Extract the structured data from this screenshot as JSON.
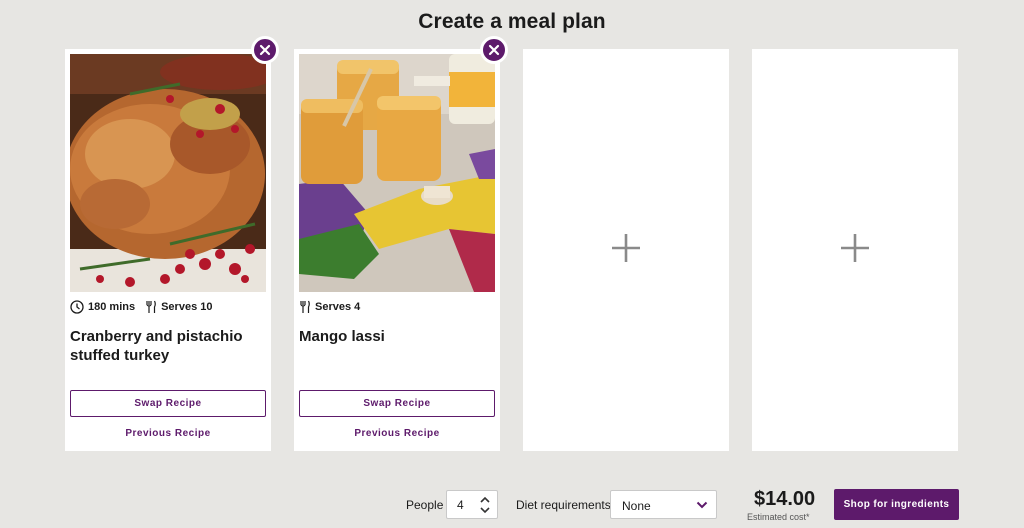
{
  "page": {
    "title": "Create a meal plan"
  },
  "cards": [
    {
      "time": "180 mins",
      "serves": "Serves 10",
      "title": "Cranberry and pistachio stuffed turkey",
      "swap_label": "Swap Recipe",
      "previous_label": "Previous Recipe"
    },
    {
      "serves": "Serves 4",
      "title": "Mango lassi",
      "swap_label": "Swap Recipe",
      "previous_label": "Previous Recipe"
    }
  ],
  "footer": {
    "people_label": "People",
    "people_value": "4",
    "diet_label": "Diet requirements",
    "diet_value": "None",
    "price": "$14.00",
    "price_caption": "Estimated cost*",
    "shop_label": "Shop for ingredients"
  },
  "colors": {
    "accent": "#5d1a6b",
    "background": "#e7e6e3",
    "card": "#ffffff"
  },
  "icons": [
    "close-icon",
    "clock-icon",
    "utensils-icon",
    "plus-icon",
    "stepper-icon",
    "chevron-down-icon"
  ]
}
